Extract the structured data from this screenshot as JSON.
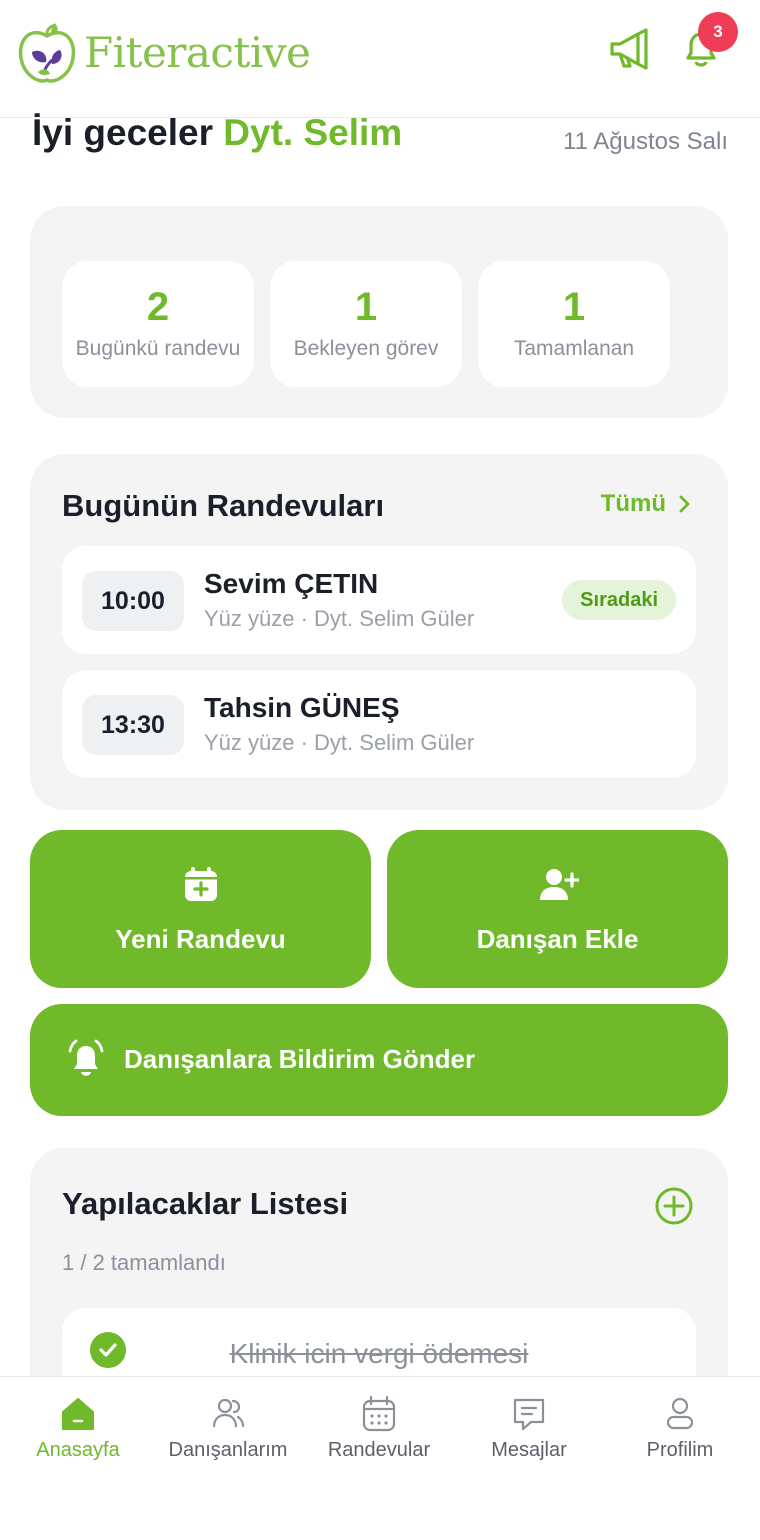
{
  "header": {
    "brand": "Fiteractive",
    "notification_count": "3"
  },
  "greeting": {
    "prefix": "İyi geceler",
    "name": "Dyt. Selim",
    "date": "11 Ağustos Salı"
  },
  "stats": [
    {
      "value": "2",
      "label": "Bugünkü randevu"
    },
    {
      "value": "1",
      "label": "Bekleyen görev"
    },
    {
      "value": "1",
      "label": "Tamamlanan"
    }
  ],
  "appointments": {
    "title": "Bugünün Randevuları",
    "all_label": "Tümü",
    "items": [
      {
        "time": "10:00",
        "name": "Sevim ÇETIN",
        "meta": "Yüz yüze · Dyt. Selim Güler",
        "badge": "Sıradaki"
      },
      {
        "time": "13:30",
        "name": "Tahsin GÜNEŞ",
        "meta": "Yüz yüze · Dyt. Selim Güler"
      }
    ]
  },
  "actions": {
    "new_appointment": "Yeni Randevu",
    "add_client": "Danışan Ekle",
    "send_notification": "Danışanlara Bildirim Gönder"
  },
  "todo": {
    "title": "Yapılacaklar Listesi",
    "progress": "1 / 2 tamamlandı",
    "items": [
      {
        "text": "Klinik icin vergi ödemesi",
        "done": true
      }
    ]
  },
  "tabs": [
    {
      "label": "Anasayfa",
      "icon": "home-icon",
      "active": true
    },
    {
      "label": "Danışanlarım",
      "icon": "users-icon"
    },
    {
      "label": "Randevular",
      "icon": "calendar-icon"
    },
    {
      "label": "Mesajlar",
      "icon": "message-icon"
    },
    {
      "label": "Profilim",
      "icon": "profile-icon"
    }
  ],
  "colors": {
    "accent": "#6fb92b",
    "badge_red": "#ee3d55",
    "card_bg": "#f4f4f5"
  }
}
